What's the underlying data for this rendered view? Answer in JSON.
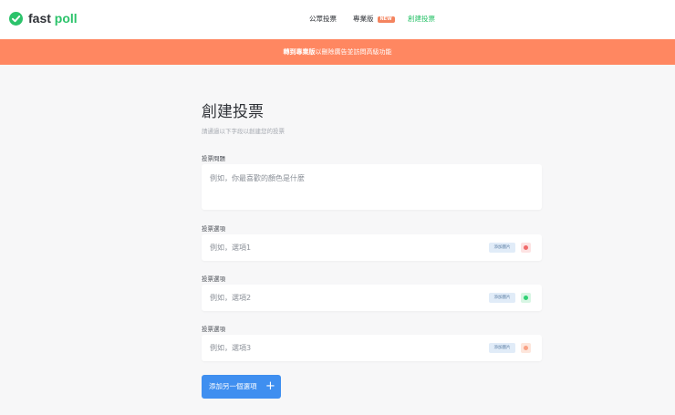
{
  "header": {
    "logo_text_main": "fast",
    "logo_text_accent": "poll",
    "nav": {
      "public_polls": "公眾投票",
      "pro": "專業版",
      "pro_badge": "NEW",
      "create_poll": "創建投票"
    }
  },
  "banner": {
    "strong_text": "轉到專業版",
    "text": "以刪除廣告並訪問高級功能"
  },
  "form": {
    "title": "創建投票",
    "subtitle": "請通過以下字段以創建您的投票",
    "question_label": "投票問題",
    "question_placeholder": "例如，你最喜歡的顏色是什麼",
    "options": [
      {
        "label": "投票選項",
        "placeholder": "例如，選項1",
        "add_image": "添加圖片",
        "color": "#f06a6a",
        "swatch_bg": "#fde3e3"
      },
      {
        "label": "投票選項",
        "placeholder": "例如，選項2",
        "add_image": "添加圖片",
        "color": "#2fd174",
        "swatch_bg": "#d8f6e4"
      },
      {
        "label": "投票選項",
        "placeholder": "例如，選項3",
        "add_image": "添加圖片",
        "color": "#f9a184",
        "swatch_bg": "#fde6dc"
      }
    ],
    "add_option_button": "添加另一個選項"
  },
  "colors": {
    "brand_green": "#2cc36b",
    "banner_orange": "#ff8761",
    "button_blue": "#3f8ff0"
  },
  "icons": {
    "logo": "check-circle-icon",
    "add": "plus-icon"
  }
}
